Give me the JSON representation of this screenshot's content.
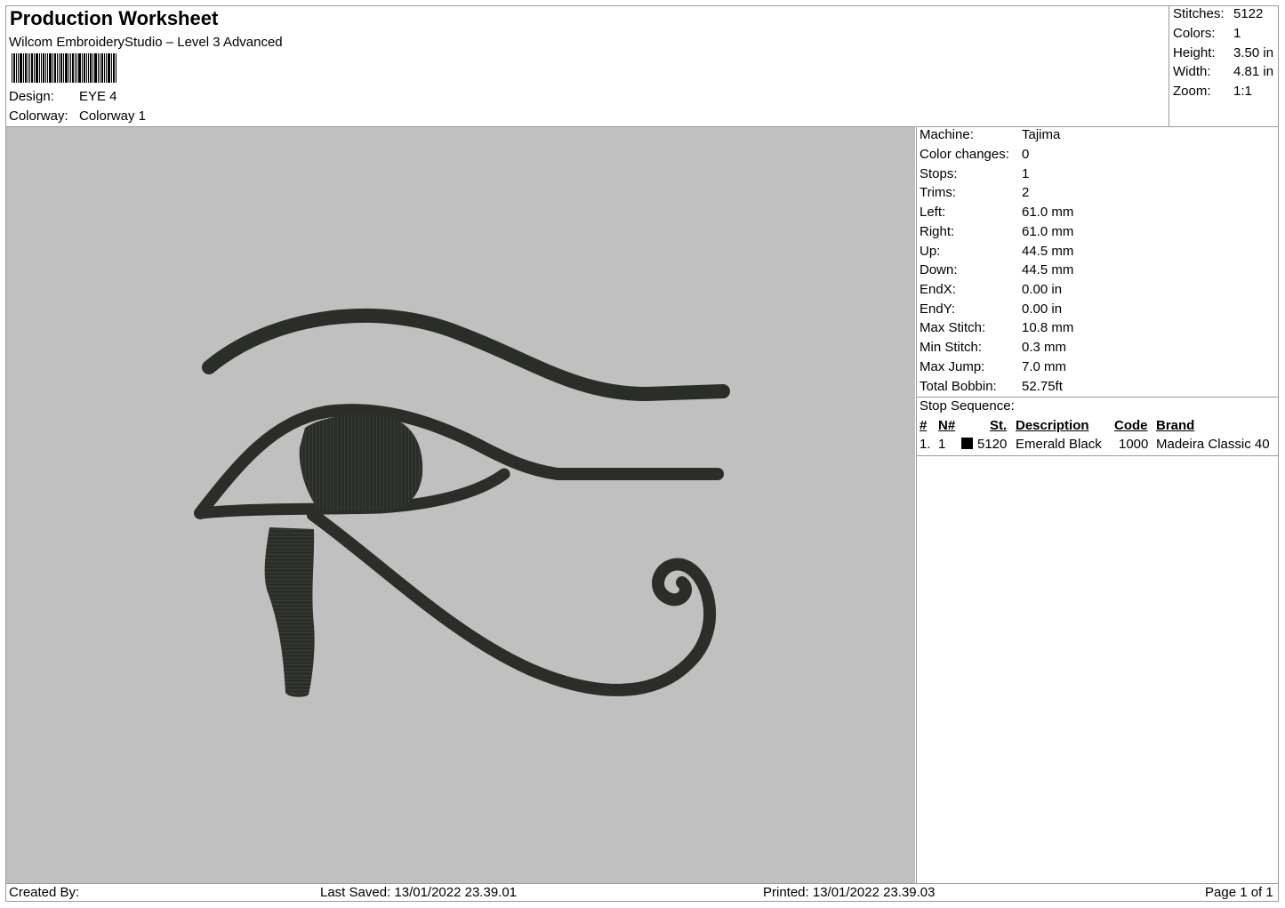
{
  "header": {
    "title": "Production Worksheet",
    "software": "Wilcom EmbroideryStudio – Level 3 Advanced",
    "design_label": "Design:",
    "design_value": "EYE 4",
    "colorway_label": "Colorway:",
    "colorway_value": "Colorway 1"
  },
  "summary": [
    {
      "label": "Stitches:",
      "value": "5122"
    },
    {
      "label": "Colors:",
      "value": "1"
    },
    {
      "label": "Height:",
      "value": "3.50 in"
    },
    {
      "label": "Width:",
      "value": "4.81 in"
    },
    {
      "label": "Zoom:",
      "value": "1:1"
    }
  ],
  "machine_info": [
    {
      "label": "Machine:",
      "value": "Tajima"
    },
    {
      "label": "Color changes:",
      "value": "0"
    },
    {
      "label": "Stops:",
      "value": "1"
    },
    {
      "label": "Trims:",
      "value": "2"
    },
    {
      "label": "Left:",
      "value": "61.0 mm"
    },
    {
      "label": "Right:",
      "value": "61.0 mm"
    },
    {
      "label": "Up:",
      "value": "44.5 mm"
    },
    {
      "label": "Down:",
      "value": "44.5 mm"
    },
    {
      "label": "EndX:",
      "value": "0.00 in"
    },
    {
      "label": "EndY:",
      "value": "0.00 in"
    },
    {
      "label": "Max Stitch:",
      "value": "10.8 mm"
    },
    {
      "label": "Min Stitch:",
      "value": "0.3 mm"
    },
    {
      "label": "Max Jump:",
      "value": "7.0 mm"
    },
    {
      "label": "Total Bobbin:",
      "value": "52.75ft"
    }
  ],
  "stop_sequence": {
    "title": "Stop Sequence:",
    "columns": {
      "index": "#",
      "needle": "N#",
      "stitches": "St.",
      "description": "Description",
      "code": "Code",
      "brand": "Brand"
    },
    "rows": [
      {
        "index": "1.",
        "needle": "1",
        "swatch_color": "#000000",
        "stitches": "5120",
        "description": "Emerald Black",
        "code": "1000",
        "brand": "Madeira Classic 40"
      }
    ]
  },
  "design_preview": {
    "background_color": "#c0c0c0",
    "thread_color": "#2b2d28"
  },
  "footer": {
    "created_by": "Created By:",
    "last_saved": "Last Saved: 13/01/2022 23.39.01",
    "printed": "Printed: 13/01/2022 23.39.03",
    "page": "Page 1 of 1"
  }
}
